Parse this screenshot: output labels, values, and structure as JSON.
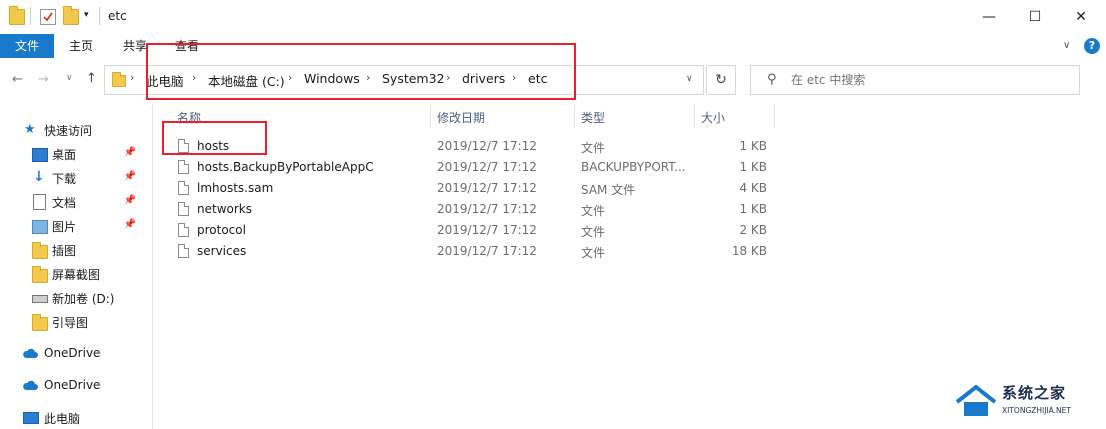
{
  "window": {
    "title": "etc",
    "minimize": "—",
    "maximize": "☐",
    "close": "✕"
  },
  "ribbon": {
    "tabs": [
      "文件",
      "主页",
      "共享",
      "查看"
    ],
    "help": "?"
  },
  "address": {
    "crumbs": [
      "此电脑",
      "本地磁盘 (C:)",
      "Windows",
      "System32",
      "drivers",
      "etc"
    ],
    "refresh": "↻"
  },
  "search": {
    "placeholder": "在 etc 中搜索"
  },
  "sidebar": {
    "items": [
      {
        "label": "快速访问",
        "icon": "star-icon"
      },
      {
        "label": "桌面",
        "icon": "desktop-icon",
        "pinned": true
      },
      {
        "label": "下载",
        "icon": "download-icon",
        "pinned": true
      },
      {
        "label": "文档",
        "icon": "document-icon",
        "pinned": true
      },
      {
        "label": "图片",
        "icon": "picture-icon",
        "pinned": true
      },
      {
        "label": "插图",
        "icon": "folder-icon"
      },
      {
        "label": "屏幕截图",
        "icon": "folder-icon"
      },
      {
        "label": "新加卷 (D:)",
        "icon": "drive-icon"
      },
      {
        "label": "引导图",
        "icon": "folder-icon"
      },
      {
        "label": "OneDrive",
        "icon": "cloud-icon"
      },
      {
        "label": "OneDrive",
        "icon": "cloud-icon"
      },
      {
        "label": "此电脑",
        "icon": "computer-icon"
      }
    ]
  },
  "table": {
    "columns": [
      "名称",
      "修改日期",
      "类型",
      "大小"
    ],
    "rows": [
      {
        "name": "hosts",
        "date": "2019/12/7 17:12",
        "type": "文件",
        "size": "1 KB"
      },
      {
        "name": "hosts.BackupByPortableAppC",
        "date": "2019/12/7 17:12",
        "type": "BACKUPBYPORT...",
        "size": "1 KB"
      },
      {
        "name": "lmhosts.sam",
        "date": "2019/12/7 17:12",
        "type": "SAM 文件",
        "size": "4 KB"
      },
      {
        "name": "networks",
        "date": "2019/12/7 17:12",
        "type": "文件",
        "size": "1 KB"
      },
      {
        "name": "protocol",
        "date": "2019/12/7 17:12",
        "type": "文件",
        "size": "2 KB"
      },
      {
        "name": "services",
        "date": "2019/12/7 17:12",
        "type": "文件",
        "size": "18 KB"
      }
    ]
  },
  "watermark": {
    "brand": "系统之家",
    "url": "XITONGZHIJIA.NET"
  },
  "colors": {
    "accent": "#1979ca",
    "highlight": "#e8202b",
    "folder": "#f2c94c"
  }
}
